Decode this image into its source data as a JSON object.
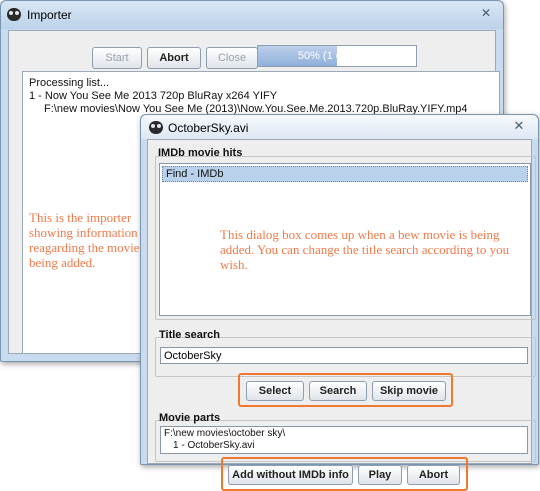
{
  "importer": {
    "title": "Importer",
    "close_glyph": "✕",
    "buttons": {
      "start": "Start",
      "abort": "Abort",
      "close": "Close"
    },
    "progress": {
      "fraction": 0.5,
      "text": "50% (1 out of 2)"
    },
    "log": [
      "Processing list...",
      "1 - Now You See Me 2013 720p BluRay x264 YIFY",
      "F:\\new movies\\Now You See Me (2013)\\Now.You.See.Me.2013.720p.BluRay.YIFY.mp4"
    ],
    "note": "This is the importer showing information reagarding the movies being added."
  },
  "dialog": {
    "title": "OctoberSky.avi",
    "close_glyph": "✕",
    "imdb_hits_label": "IMDb movie hits",
    "imdb_hits": [
      "Find - IMDb"
    ],
    "note": "This dialog box comes up when a bew movie is being added. You can change the title search according to you wish.",
    "title_search_label": "Title search",
    "title_search_value": "OctoberSky",
    "buttons": {
      "select": "Select",
      "search": "Search",
      "skip_movie": "Skip movie",
      "add_without_imdb": "Add without IMDb info",
      "play": "Play",
      "abort": "Abort"
    },
    "movie_parts_label": "Movie parts",
    "movie_parts": [
      "F:\\new movies\\october sky\\",
      "1  - OctoberSky.avi"
    ]
  },
  "colors": {
    "annotation": "#f07a4a",
    "highlight_border": "#f0782f",
    "selection": "#b9d1ea",
    "progress_fill": "#8fb0da"
  }
}
